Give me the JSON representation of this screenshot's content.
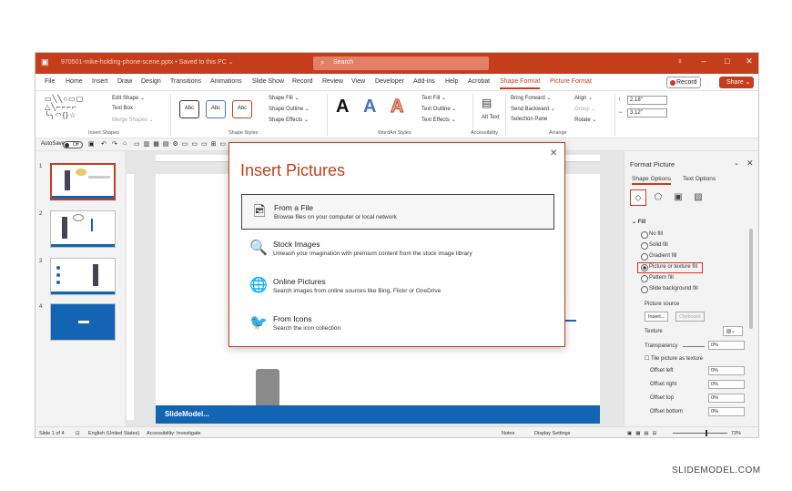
{
  "titlebar": {
    "filename": "970501-mike-holding-phone-scene.pptx • Saved to this PC ⌄",
    "search_placeholder": "Search"
  },
  "menu": {
    "tabs": [
      "File",
      "Home",
      "Insert",
      "Draw",
      "Design",
      "Transitions",
      "Animations",
      "Slide Show",
      "Record",
      "Review",
      "View",
      "Developer",
      "Add-ins",
      "Help",
      "Acrobat",
      "Shape Format",
      "Picture Format"
    ],
    "active": "Shape Format",
    "record_label": "Record",
    "share_label": "Share ⌄"
  },
  "ribbon": {
    "insert_shapes": {
      "label": "Insert Shapes",
      "edit_shape": "Edit Shape ⌄",
      "text_box": "Text Box",
      "merge_shapes": "Merge Shapes ⌄"
    },
    "shape_styles": {
      "label": "Shape Styles",
      "sample": "Abc",
      "fill": "Shape Fill ⌄",
      "outline": "Shape Outline ⌄",
      "effects": "Shape Effects ⌄"
    },
    "wordart": {
      "label": "WordArt Styles",
      "sample": "A",
      "text_fill": "Text Fill ⌄",
      "text_outline": "Text Outline ⌄",
      "text_effects": "Text Effects ⌄"
    },
    "accessibility": {
      "label": "Accessibility",
      "alt_text": "Alt Text"
    },
    "arrange": {
      "label": "Arrange",
      "bring_forward": "Bring Forward ⌄",
      "send_backward": "Send Backward ⌄",
      "selection_pane": "Selection Pane",
      "align": "Align ⌄",
      "group": "Group ⌄",
      "rotate": "Rotate ⌄"
    },
    "size": {
      "height": "2.18\"",
      "width": "3.12\""
    }
  },
  "qat": {
    "autosave": "AutoSave",
    "toggle": "Off"
  },
  "slides": {
    "numbers": [
      "1",
      "2",
      "3",
      "4"
    ],
    "current": 1
  },
  "slide": {
    "logo": "SlideModel..."
  },
  "dialog": {
    "title": "Insert Pictures",
    "options": [
      {
        "title": "From a File",
        "subtitle": "Browse files on your computer or local network",
        "icon": "file-image-icon"
      },
      {
        "title": "Stock Images",
        "subtitle": "Unleash your imagination with premium content from the stock image library",
        "icon": "stock-images-icon"
      },
      {
        "title": "Online Pictures",
        "subtitle": "Search images from online sources like Bing, Flickr or OneDrive",
        "icon": "online-pictures-icon"
      },
      {
        "title": "From Icons",
        "subtitle": "Search the icon collection",
        "icon": "icons-icon"
      }
    ]
  },
  "format_pane": {
    "title": "Format Picture",
    "tabs": [
      "Shape Options",
      "Text Options"
    ],
    "section": "Fill",
    "fill_options": [
      "No fill",
      "Solid fill",
      "Gradient fill",
      "Picture or texture fill",
      "Pattern fill",
      "Slide background fill"
    ],
    "selected_fill": "Picture or texture fill",
    "picture_source": "Picture source",
    "insert_btn": "Insert...",
    "clipboard_btn": "Clipboard",
    "texture": "Texture",
    "transparency": "Transparency",
    "transparency_value": "0%",
    "tile": "Tile picture as texture",
    "offsets": [
      {
        "label": "Offset left",
        "value": "0%"
      },
      {
        "label": "Offset right",
        "value": "0%"
      },
      {
        "label": "Offset top",
        "value": "0%"
      },
      {
        "label": "Offset bottom",
        "value": "0%"
      }
    ]
  },
  "status": {
    "slide_of": "Slide 1 of 4",
    "language": "English (United States)",
    "accessibility": "Accessibility: Investigate",
    "notes": "Notes",
    "display": "Display Settings",
    "zoom": "73%"
  },
  "watermark": "SLIDEMODEL.COM",
  "colors": {
    "accent": "#c43e1c",
    "slide_blue": "#1464b4",
    "highlight": "#e0301e"
  }
}
